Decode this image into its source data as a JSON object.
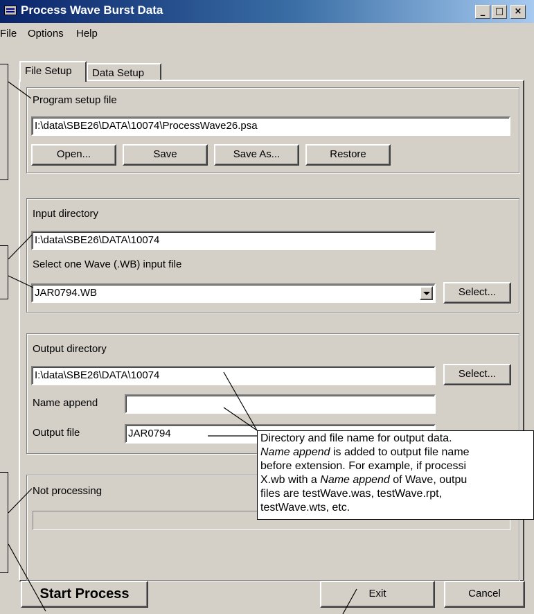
{
  "window": {
    "title": "Process Wave Burst Data",
    "controls": {
      "minimize": "_",
      "maximize": "□",
      "close": "×"
    }
  },
  "menu": [
    "File",
    "Options",
    "Help"
  ],
  "tabs": [
    {
      "label": "File Setup",
      "active": true
    },
    {
      "label": "Data Setup",
      "active": false
    }
  ],
  "program_setup": {
    "group_label": "Program setup file",
    "path": "I:\\data\\SBE26\\DATA\\10074\\ProcessWave26.psa",
    "buttons": {
      "open": "Open...",
      "save": "Save",
      "save_as": "Save As...",
      "restore": "Restore"
    }
  },
  "input": {
    "group_label": "Input directory",
    "directory": "I:\\data\\SBE26\\DATA\\10074",
    "select_label": "Select one Wave (.WB) input file",
    "file": "JAR0794.WB",
    "select_button": "Select..."
  },
  "output": {
    "group_label": "Output directory",
    "directory": "I:\\data\\SBE26\\DATA\\10074",
    "select_button": "Select...",
    "name_append_label": "Name append",
    "name_append_value": "",
    "output_file_label": "Output file",
    "output_file_value": "JAR0794"
  },
  "status": {
    "text": "Not processing"
  },
  "footer": {
    "start_button": "Start Process",
    "exit_button": "Exit",
    "cancel_button": "Cancel"
  },
  "callout": {
    "lines": [
      "Directory and file name for output data.",
      "Name append is added to output file name",
      "before extension. For example, if processi",
      "X.wb with a Name append of Wave, outpu",
      "files are testWave.was, testWave.rpt,",
      "testWave.wts, etc."
    ]
  },
  "colors": {
    "face": "#d4d0c8",
    "title_start": "#0a246a",
    "title_end": "#a6caf0"
  }
}
